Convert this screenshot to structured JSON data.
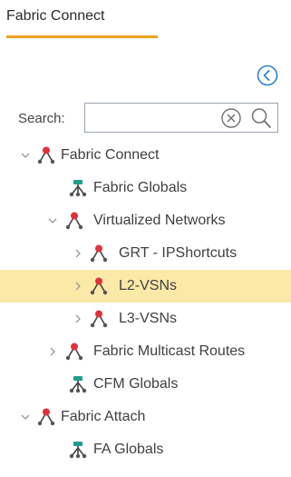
{
  "tab": {
    "label": "Fabric Connect"
  },
  "search": {
    "label": "Search:",
    "value": "",
    "placeholder": ""
  },
  "colors": {
    "tab_underline": "#f0a020",
    "selection": "#fbe9a8",
    "node_red": "#e0323c",
    "node_teal": "#1f9e8c",
    "collapse_blue": "#2f7fd6"
  },
  "tree": {
    "items": [
      {
        "label": "Fabric Connect",
        "expanded": true,
        "icon": "fabric-node-icon"
      },
      {
        "label": "Fabric Globals",
        "expanded": null,
        "icon": "fabric-globals-icon"
      },
      {
        "label": "Virtualized Networks",
        "expanded": true,
        "icon": "fabric-node-icon"
      },
      {
        "label": "GRT - IPShortcuts",
        "expanded": false,
        "icon": "fabric-node-icon"
      },
      {
        "label": "L2-VSNs",
        "expanded": false,
        "icon": "fabric-node-icon",
        "selected": true
      },
      {
        "label": "L3-VSNs",
        "expanded": false,
        "icon": "fabric-node-icon"
      },
      {
        "label": "Fabric Multicast Routes",
        "expanded": false,
        "icon": "fabric-node-icon"
      },
      {
        "label": "CFM Globals",
        "expanded": null,
        "icon": "fabric-globals-icon"
      },
      {
        "label": "Fabric Attach",
        "expanded": true,
        "icon": "fabric-node-icon"
      },
      {
        "label": "FA Globals",
        "expanded": null,
        "icon": "fabric-globals-icon"
      }
    ]
  }
}
